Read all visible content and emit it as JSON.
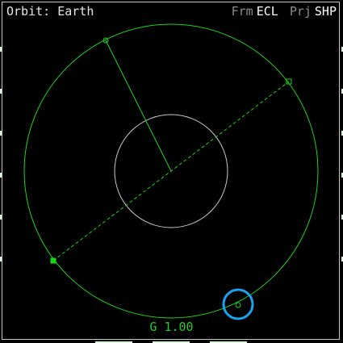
{
  "header": {
    "title": "Orbit: Earth",
    "frame_label": "Frm",
    "frame_value": "ECL",
    "projection_label": "Prj",
    "projection_value": "SHP"
  },
  "readout": {
    "text": "G 1.00"
  },
  "colors": {
    "orbit": "#18d418",
    "planet": "#c8c8c8",
    "highlight": "#1aa3ee",
    "frame": "#c8c8c8"
  }
}
